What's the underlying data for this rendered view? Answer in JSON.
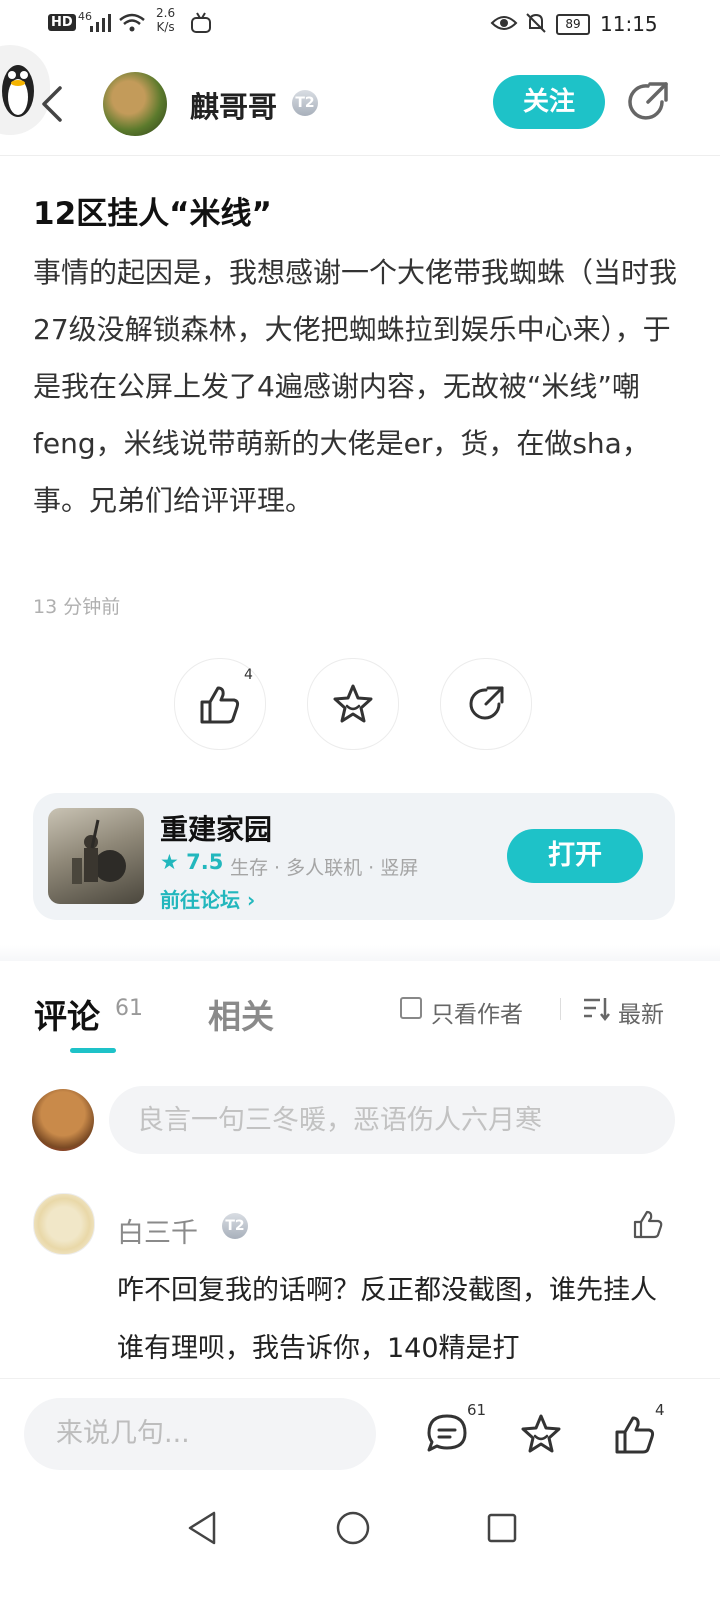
{
  "status_bar": {
    "hd": "HD",
    "signal": "46",
    "speed_value": "2.6",
    "speed_unit": "K/s",
    "battery": "89",
    "time": "11:15"
  },
  "header": {
    "author_name": "麒哥哥",
    "level_badge": "T2",
    "follow_label": "关注"
  },
  "post": {
    "title": "12区挂人“米线”",
    "body": "事情的起因是，我想感谢一个大佬带我蜘蛛（当时我27级没解锁森林，大佬把蜘蛛拉到娱乐中心来），于是我在公屏上发了4遍感谢内容，无故被“米线”嘲feng，米线说带萌新的大佬是er，货，在做sha，事。兄弟们给评评理。",
    "time": "13 分钟前",
    "like_count": "4"
  },
  "game_card": {
    "name": "重建家园",
    "rating": "★ 7.5",
    "tags": "生存 · 多人联机 · 竖屏",
    "forum_link": "前往论坛 ›",
    "open_label": "打开"
  },
  "tabs": {
    "comment_label": "评论",
    "comment_count": "61",
    "related_label": "相关",
    "author_only_label": "只看作者",
    "sort_label": "最新"
  },
  "comment_input": {
    "placeholder": "良言一句三冬暖，恶语伤人六月寒"
  },
  "comments": [
    {
      "name": "白三千",
      "badge": "T2",
      "text": "咋不回复我的话啊？反正都没截图，谁先挂人谁有理呗，我告诉你，140精是打"
    }
  ],
  "bottom_bar": {
    "say_placeholder": "来说几句...",
    "comment_count": "61",
    "like_count": "4"
  },
  "icons": {
    "back": "chevron-left-icon",
    "share": "share-icon",
    "like": "thumbs-up-icon",
    "favorite": "star-icon",
    "comment": "comment-bubble-icon"
  },
  "colors": {
    "accent": "#1ec2c8",
    "card_bg": "#f0f3f6"
  }
}
